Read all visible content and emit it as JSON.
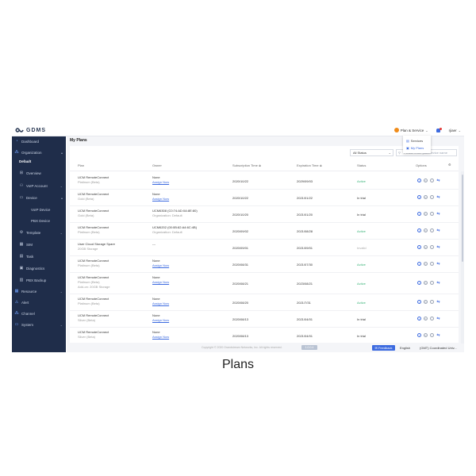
{
  "app": {
    "logo_text": "GDMS"
  },
  "topbar": {
    "plan_service": "Plan & Service",
    "user": "rjiaer"
  },
  "dropdown": {
    "items": [
      {
        "label": "Services"
      },
      {
        "label": "My Plans"
      }
    ]
  },
  "sidebar": {
    "items": [
      {
        "label": "Dashboard"
      },
      {
        "label": "Organization"
      },
      {
        "label": "Default"
      },
      {
        "label": "Overview"
      },
      {
        "label": "VoIP Account"
      },
      {
        "label": "Device"
      },
      {
        "label": "VoIP Device"
      },
      {
        "label": "PBX Device"
      },
      {
        "label": "Template"
      },
      {
        "label": "SIM"
      },
      {
        "label": "Task"
      },
      {
        "label": "Diagnostics"
      },
      {
        "label": "PBX Backup"
      },
      {
        "label": "Resource"
      },
      {
        "label": "Alert"
      },
      {
        "label": "Channel"
      },
      {
        "label": "System"
      }
    ]
  },
  "main": {
    "title": "My Plans",
    "filter_value": "All Status",
    "search_placeholder": "Please enter plan/device name",
    "columns": {
      "plan": "Plan",
      "owner": "Owner",
      "subscription": "Subscription Time ≑",
      "expiration": "Expiration Time ≑",
      "status": "Status",
      "options": "Options"
    },
    "rows": [
      {
        "plan": "UCM RemoteConnect",
        "plan2": "Platinum (Beta)",
        "owner": "None",
        "owner2": "Assign Now",
        "owner_link": true,
        "sub": "2020/10/22",
        "exp": "2029/09/03",
        "status": "Active",
        "status_class": "active"
      },
      {
        "plan": "UCM RemoteConnect",
        "plan2": "Gold (Beta)",
        "owner": "None",
        "owner2": "Assign Now",
        "owner_link": true,
        "sub": "2020/10/22",
        "exp": "2021/01/22",
        "status": "In trial",
        "status_class": "trial"
      },
      {
        "plan": "UCM RemoteConnect",
        "plan2": "Gold (Beta)",
        "owner": "UCM6308 (C0:74:AD:0A:8E:80)",
        "owner2": "Organization: Default",
        "owner_link": false,
        "sub": "2020/10/20",
        "exp": "2021/01/20",
        "status": "In trial",
        "status_class": "trial"
      },
      {
        "plan": "UCM RemoteConnect",
        "plan2": "Platinum (Beta)",
        "owner": "UCM6202 (00:0B:82:A4:6C:4B)",
        "owner2": "Organization: Default",
        "owner_link": false,
        "sub": "2020/09/02",
        "exp": "2021/08/28",
        "status": "Active",
        "status_class": "active"
      },
      {
        "plan": "User Cloud Storage Spare",
        "plan2": "20GB Storage",
        "owner": "---",
        "owner2": "",
        "owner_link": false,
        "sub": "2020/09/01",
        "exp": "2021/09/01",
        "status": "Invalid",
        "status_class": "invalid"
      },
      {
        "plan": "UCM RemoteConnect",
        "plan2": "Platinum (Beta)",
        "owner": "None",
        "owner2": "Assign Now",
        "owner_link": true,
        "sub": "2020/08/31",
        "exp": "2021/07/30",
        "status": "Active",
        "status_class": "active"
      },
      {
        "plan": "UCM RemoteConnect",
        "plan2": "Platinum (Beta)",
        "plan3": "Add-on: 20GB Storage",
        "owner": "None",
        "owner2": "Assign Now",
        "owner_link": true,
        "sub": "2020/08/21",
        "exp": "2023/08/21",
        "status": "Active",
        "status_class": "active"
      },
      {
        "plan": "UCM RemoteConnect",
        "plan2": "Platinum (Beta)",
        "owner": "None",
        "owner2": "Assign Now",
        "owner_link": true,
        "sub": "2020/08/20",
        "exp": "2021/7/31",
        "status": "Active",
        "status_class": "active"
      },
      {
        "plan": "UCM RemoteConnect",
        "plan2": "Silver (Beta)",
        "owner": "None",
        "owner2": "Assign Now",
        "owner_link": true,
        "sub": "2020/08/13",
        "exp": "2021/04/01",
        "status": "In trial",
        "status_class": "trial"
      },
      {
        "plan": "UCM RemoteConnect",
        "plan2": "Silver (Beta)",
        "owner": "None",
        "owner2": "Assign Now",
        "owner_link": true,
        "sub": "2020/08/13",
        "exp": "2021/04/01",
        "status": "In trial",
        "status_class": "trial"
      }
    ]
  },
  "footer": {
    "copyright": "Copyright © 2020 Grandstream Networks, Inc. All rights reserved.",
    "button": "1.0.0.4",
    "feedback": "Feedback",
    "language": "English",
    "timezone": "(GMT) Coordinated Univ..."
  },
  "caption": "Plans"
}
